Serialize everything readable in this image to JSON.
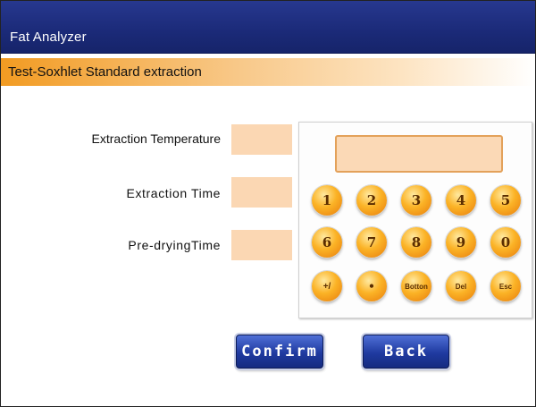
{
  "app": {
    "title": "Fat Analyzer"
  },
  "header": {
    "subtitle": "Test-Soxhlet Standard  extraction"
  },
  "fields": [
    {
      "label": "Extraction Temperature",
      "value": ""
    },
    {
      "label": "Extraction Time",
      "value": ""
    },
    {
      "label": "Pre-dryingTime",
      "value": ""
    }
  ],
  "keypad": {
    "display_value": "",
    "keys": [
      "1",
      "2",
      "3",
      "4",
      "5",
      "6",
      "7",
      "8",
      "9",
      "0",
      "+/",
      "•",
      "Botton",
      "Del",
      "Esc"
    ]
  },
  "buttons": {
    "confirm": "Confirm",
    "back": "Back"
  },
  "colors": {
    "titlebar": "#1b2a78",
    "accent": "#f29b22",
    "input_fill": "#fbd7b3",
    "key": "#fbb326"
  }
}
